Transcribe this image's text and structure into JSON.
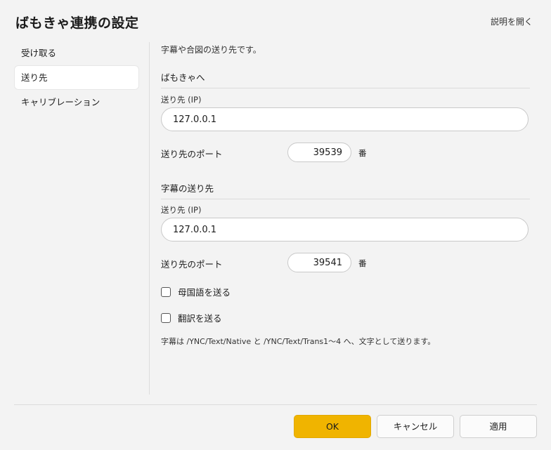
{
  "window": {
    "title": "ばもきゃ連携の設定",
    "help_link": "説明を開く"
  },
  "sidebar": {
    "items": [
      {
        "label": "受け取る",
        "active": false
      },
      {
        "label": "送り先",
        "active": true
      },
      {
        "label": "キャリブレーション",
        "active": false
      }
    ]
  },
  "main": {
    "description": "字幕や合図の送り先です。",
    "bamokya": {
      "header": "ばもきゃへ",
      "ip_label": "送り先 (IP)",
      "ip_value": "127.0.0.1",
      "port_label": "送り先のポート",
      "port_value": "39539",
      "port_unit": "番"
    },
    "subtitle": {
      "header": "字幕の送り先",
      "ip_label": "送り先 (IP)",
      "ip_value": "127.0.0.1",
      "port_label": "送り先のポート",
      "port_value": "39541",
      "port_unit": "番"
    },
    "checkboxes": [
      {
        "label": "母国語を送る",
        "checked": false
      },
      {
        "label": "翻訳を送る",
        "checked": false
      }
    ],
    "note": "字幕は /YNC/Text/Native と /YNC/Text/Trans1〜4 へ、文字として送ります。"
  },
  "footer": {
    "ok_label": "OK",
    "cancel_label": "キャンセル",
    "apply_label": "適用"
  },
  "colors": {
    "accent": "#f0b400",
    "background": "#f3f3f3"
  }
}
